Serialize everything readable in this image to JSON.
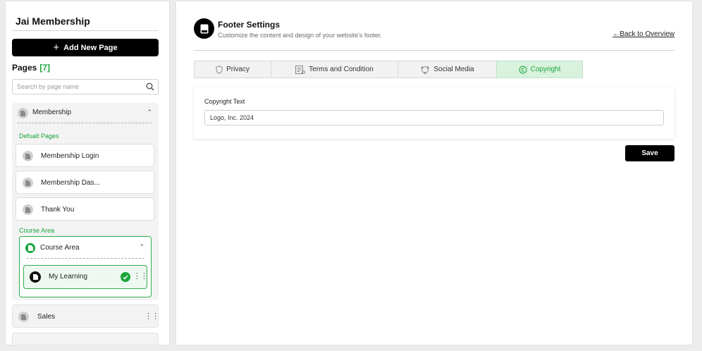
{
  "sidebar": {
    "app_title": "Jai Membership",
    "add_button_label": "Add New Page",
    "pages_heading": "Pages",
    "pages_count": "[7]",
    "search_placeholder": "Search by page name",
    "membership_group": {
      "title": "Membership",
      "default_section_label": "Defualt Pages",
      "default_pages": [
        "Membership Login",
        "Membership Das...",
        "Thank You"
      ],
      "course_section_label": "Course Area",
      "course_group": {
        "title": "Course Area",
        "pages": [
          "My Learning"
        ]
      }
    },
    "sales_page": "Sales"
  },
  "main": {
    "title": "Footer Settings",
    "subtitle": "Customize the content and design of your website's footer.",
    "back_link": "Back to Overview",
    "tabs": [
      {
        "label": "Privacy",
        "icon": "shield-icon"
      },
      {
        "label": "Terms and Condition",
        "icon": "document-list-icon"
      },
      {
        "label": "Social Media",
        "icon": "social-network-icon"
      },
      {
        "label": "Copyright",
        "icon": "copyright-icon",
        "active": true
      }
    ],
    "copyright": {
      "field_label": "Copyright Text",
      "field_value": "Logo, Inc. 2024"
    },
    "save_label": "Save"
  },
  "colors": {
    "accent_green": "#1aa53a",
    "active_tab_bg": "#d9f2de",
    "primary_button": "#000000"
  }
}
